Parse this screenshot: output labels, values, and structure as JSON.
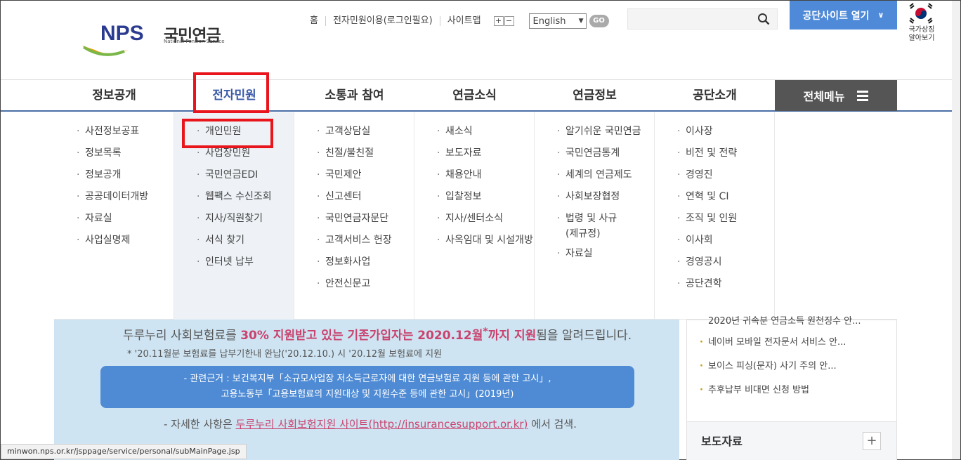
{
  "header": {
    "logo_main": "NPS",
    "logo_text": "국민연금",
    "logo_sub": "National Pension Service",
    "util_links": [
      "홈",
      "전자민원이용(로그인필요)",
      "사이트맵"
    ],
    "zoom_in": "+",
    "zoom_out": "−",
    "language": "English",
    "go_label": "GO",
    "search_placeholder": "",
    "open_site_label": "공단사이트 열기",
    "flag_label_1": "국가상징",
    "flag_label_2": "알아보기"
  },
  "gnb": {
    "items": [
      "정보공개",
      "전자민원",
      "소통과 참여",
      "연금소식",
      "연금정보",
      "공단소개"
    ],
    "all_menu": "전체메뉴"
  },
  "mega": {
    "columns": [
      [
        "사전정보공표",
        "정보목록",
        "정보공개",
        "공공데이터개방",
        "자료실",
        "사업실명제"
      ],
      [
        "개인민원",
        "사업장민원",
        "국민연금EDI",
        "웹팩스 수신조회",
        "지사/직원찾기",
        "서식 찾기",
        "인터넷 납부"
      ],
      [
        "고객상담실",
        "친절/불친절",
        "국민제안",
        "신고센터",
        "국민연금자문단",
        "고객서비스 헌장",
        "정보화사업",
        "안전신문고"
      ],
      [
        "새소식",
        "보도자료",
        "채용안내",
        "입찰정보",
        "지사/센터소식",
        "사옥임대 및 시설개방"
      ],
      [
        "알기쉬운 국민연금",
        "국민연금통계",
        "세계의 연금제도",
        "사회보장협정",
        "법령 및 사규(제규정)",
        "자료실"
      ],
      [
        "이사장",
        "비전 및 전략",
        "경영진",
        "연혁 및 CI",
        "조직 및 인원",
        "이사회",
        "경영공시",
        "공단견학"
      ]
    ]
  },
  "banner": {
    "line1_a": "두루누리 사회보험료를 ",
    "line1_b": "30% 지원받고 있는 기존가입자는 2020.12월",
    "line1_star": "*",
    "line1_c": "까지 지원",
    "line1_d": "됨을 알려드립니다.",
    "line2": "* '20.11월분 보험료를 납부기한내 완납('20.12.10.) 시 '20.12월 보험료에 지원",
    "box_line1": "- 관련근거 : 보건복지부「소규모사업장 저소득근로자에 대한 연금보험료 지원 등에 관한 고시」,",
    "box_line2": "고용노동부「고용보험료의 지원대상 및 지원수준 등에 관한 고시」(2019년)",
    "line3_a": "- 자세한 사항은 ",
    "line3_link": "두루누리 사회보험지원 사이트(http://insurancesupport.or.kr)",
    "line3_b": " 에서 검색."
  },
  "news": {
    "cut_item": "2020년 귀속분 연금소득 원천징수 안...",
    "items": [
      "네이버 모바일 전자문서 서비스 안...",
      "보이스 피싱(문자) 사기 주의 안...",
      "추후납부 비대면 신청 방법"
    ],
    "press_title": "보도자료",
    "press_plus": "+"
  },
  "status_url": "minwon.nps.or.kr/jsppage/service/personal/subMainPage.jsp",
  "colors": {
    "accent": "#4f8ad8",
    "highlight": "#e8161c",
    "active": "#3a5aa8"
  }
}
